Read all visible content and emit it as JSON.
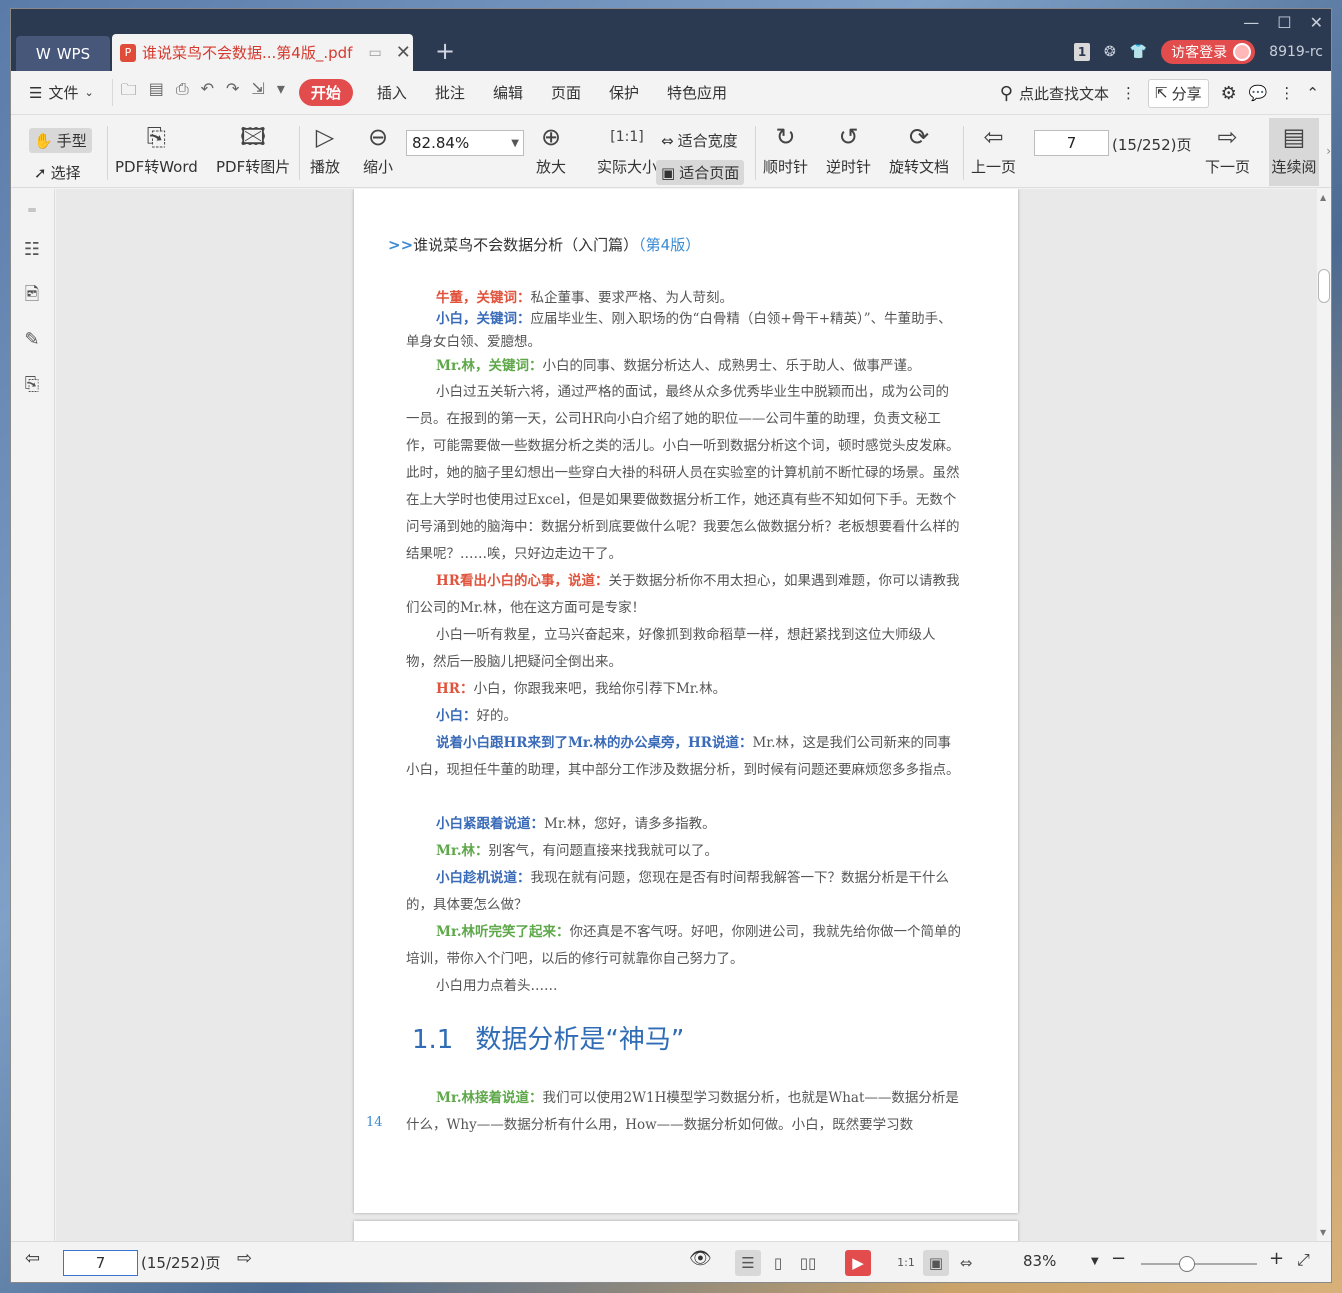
{
  "titlebar": {
    "wps_tab": "WPS",
    "doc_tab": "谁说菜鸟不会数据...第4版_.pdf",
    "page_badge": "1",
    "login": "访客登录",
    "user": "8919-rc"
  },
  "menubar": {
    "file": "文件",
    "items": [
      "开始",
      "插入",
      "批注",
      "编辑",
      "页面",
      "保护",
      "特色应用"
    ],
    "search": "点此查找文本",
    "share": "分享"
  },
  "toolbar": {
    "hand": "手型",
    "select": "选择",
    "pdf2word": "PDF转Word",
    "pdf2img": "PDF转图片",
    "play": "播放",
    "zoom_out": "缩小",
    "zoom_value": "82.84%",
    "zoom_in": "放大",
    "actual_size": "实际大小",
    "fit_width": "适合宽度",
    "fit_page": "适合页面",
    "clockwise": "顺时针",
    "counter_clockwise": "逆时针",
    "rotate_doc": "旋转文档",
    "prev_page": "上一页",
    "page_value": "7",
    "page_total": "(15/252)页",
    "next_page": "下一页",
    "continuous": "连续阅"
  },
  "document": {
    "running_head_prefix": ">>",
    "running_head": "谁说菜鸟不会数据分析（入门篇）",
    "running_head_edition": "（第4版）",
    "page_number": "14",
    "section_num": "1.1",
    "section_title": "数据分析是“神马”",
    "p1_kw": "牛董，关键词：",
    "p1": "私企董事、要求严格、为人苛刻。",
    "p2_kw": "小白，关键词：",
    "p2": "应届毕业生、刚入职场的伪“白骨精（白领+骨干+精英）”、牛董助手、单身女白领、爱臆想。",
    "p3_kw": "Mr.林，关键词：",
    "p3": "小白的同事、数据分析达人、成熟男士、乐于助人、做事严谨。",
    "p4": "小白过五关斩六将，通过严格的面试，最终从众多优秀毕业生中脱颖而出，成为公司的一员。在报到的第一天，公司HR向小白介绍了她的职位——公司牛董的助理，负责文秘工作，可能需要做一些数据分析之类的活儿。小白一听到数据分析这个词，顿时感觉头皮发麻。此时，她的脑子里幻想出一些穿白大褂的科研人员在实验室的计算机前不断忙碌的场景。虽然在上大学时也使用过Excel，但是如果要做数据分析工作，她还真有些不知如何下手。无数个问号涌到她的脑海中：数据分析到底要做什么呢？我要怎么做数据分析？老板想要看什么样的结果呢？……唉，只好边走边干了。",
    "p5_kw": "HR看出小白的心事，说道：",
    "p5": "关于数据分析你不用太担心，如果遇到难题，你可以请教我们公司的Mr.林，他在这方面可是专家！",
    "p6": "小白一听有救星，立马兴奋起来，好像抓到救命稻草一样，想赶紧找到这位大师级人物，然后一股脑儿把疑问全倒出来。",
    "p7_kw": "HR：",
    "p7": "小白，你跟我来吧，我给你引荐下Mr.林。",
    "p8_kw": "小白：",
    "p8": "好的。",
    "p9_kw": "说着小白跟HR来到了Mr.林的办公桌旁，HR说道：",
    "p9": "Mr.林，这是我们公司新来的同事小白，现担任牛董的助理，其中部分工作涉及数据分析，到时候有问题还要麻烦您多多指点。",
    "p10_kw": "小白紧跟着说道：",
    "p10": "Mr.林，您好，请多多指教。",
    "p11_kw": "Mr.林：",
    "p11": "别客气，有问题直接来找我就可以了。",
    "p12_kw": "小白趁机说道：",
    "p12": "我现在就有问题，您现在是否有时间帮我解答一下？数据分析是干什么的，具体要怎么做？",
    "p13_kw": "Mr.林听完笑了起来：",
    "p13": "你还真是不客气呀。好吧，你刚进公司，我就先给你做一个简单的培训，带你入个门吧，以后的修行可就靠你自己努力了。",
    "p14": "小白用力点着头……",
    "p15_kw": "Mr.林接着说道：",
    "p15": "我们可以使用2W1H模型学习数据分析，也就是What——数据分析是什么，Why——数据分析有什么用，How——数据分析如何做。小白，既然要学习数"
  },
  "statusbar": {
    "page_value": "7",
    "page_total": "(15/252)页",
    "zoom": "83%"
  },
  "colors": {
    "accent_red": "#e24c4c",
    "title_bar": "#2c3a51",
    "heading_blue": "#2f6cb5",
    "keyword_red": "#e0533c",
    "keyword_blue": "#3a6bb8",
    "keyword_green": "#5ea84a"
  }
}
